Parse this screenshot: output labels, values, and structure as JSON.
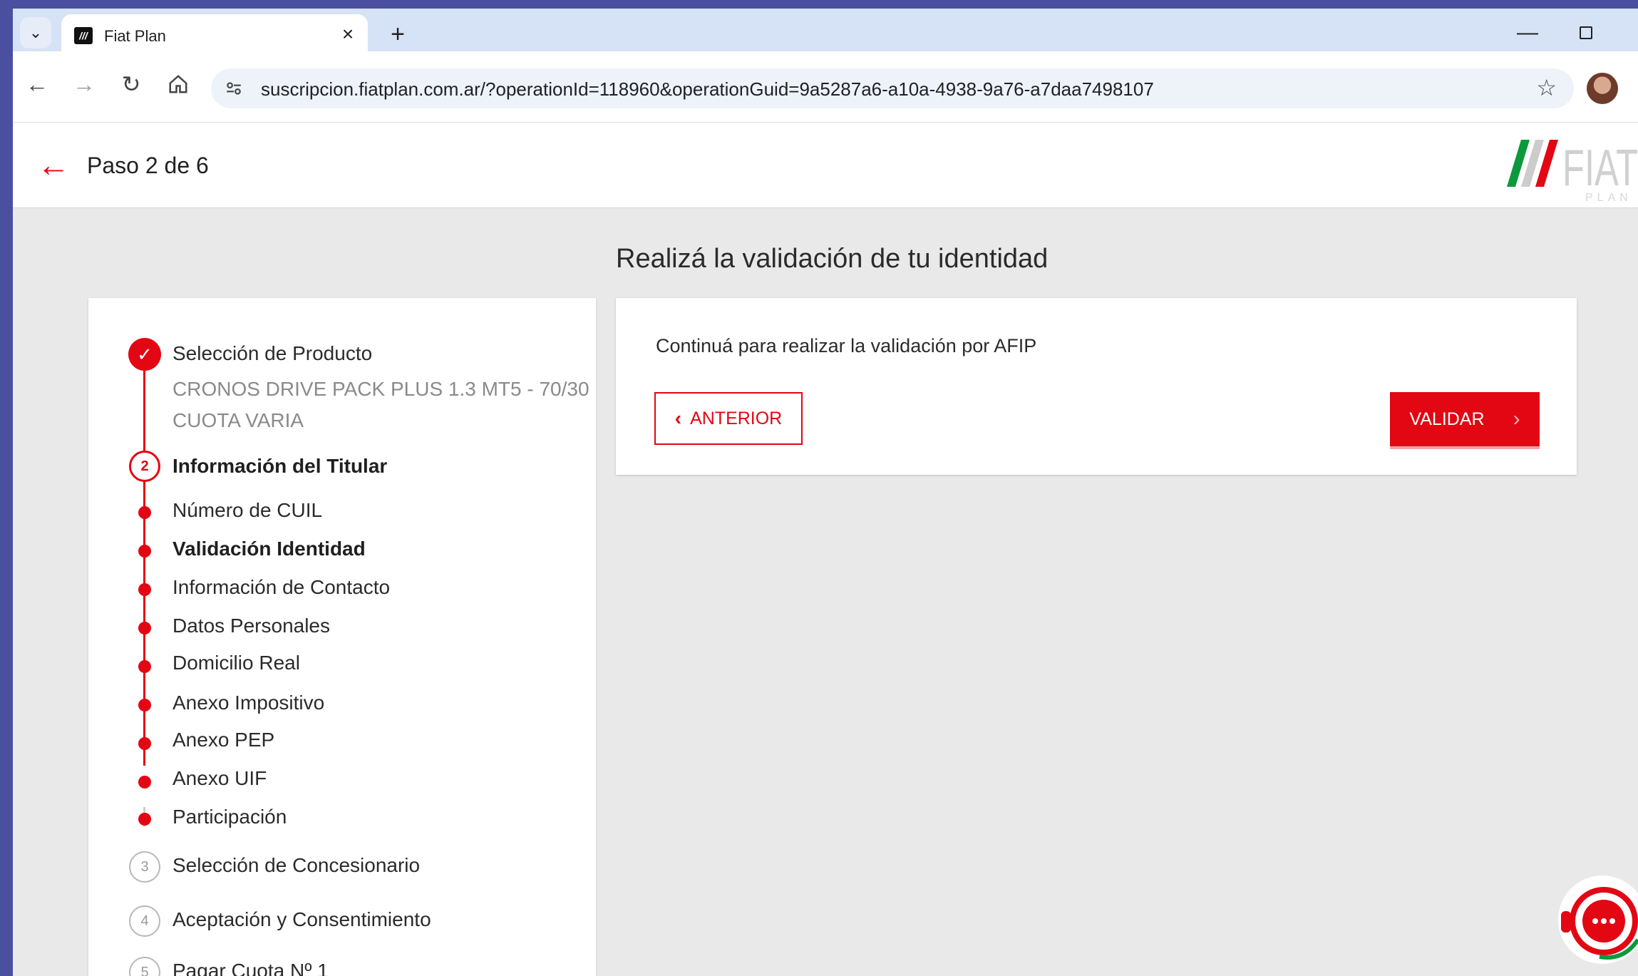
{
  "browser": {
    "tab_title": "Fiat Plan",
    "tab_favicon_text": "///",
    "url": "suscripcion.fiatplan.com.ar/?operationId=118960&operationGuid=9a5287a6-a10a-4938-9a76-a7daa7498107",
    "icons": [
      "tab-switch-icon",
      "close-icon",
      "plus-icon",
      "minimize-icon",
      "maximize-icon",
      "back-icon",
      "forward-icon",
      "reload-icon",
      "home-icon",
      "site-info-icon",
      "star-icon",
      "profile-avatar"
    ]
  },
  "header": {
    "step_label": "Paso 2 de 6",
    "logo_text": "FIAT",
    "logo_subtext": "PLAN"
  },
  "main": {
    "title": "Realizá la validación de tu identidad"
  },
  "steps": {
    "step1": {
      "label": "Selección de Producto",
      "product_line1": "CRONOS DRIVE PACK PLUS 1.3 MT5 - 70/30",
      "product_line2": "CUOTA VARIA"
    },
    "step2": {
      "number": "2",
      "label": "Información del Titular",
      "substeps": [
        {
          "label": "Número de CUIL"
        },
        {
          "label": "Validación Identidad"
        },
        {
          "label": "Información de Contacto"
        },
        {
          "label": "Datos Personales"
        },
        {
          "label": "Domicilio Real"
        },
        {
          "label": "Anexo Impositivo"
        },
        {
          "label": "Anexo PEP"
        },
        {
          "label": "Anexo UIF"
        },
        {
          "label": "Participación"
        }
      ]
    },
    "step3": {
      "number": "3",
      "label": "Selección de Concesionario"
    },
    "step4": {
      "number": "4",
      "label": "Aceptación y Consentimiento"
    },
    "step5": {
      "number": "5",
      "label": "Pagar Cuota Nº 1"
    }
  },
  "action": {
    "message": "Continuá para realizar la validación por AFIP",
    "back_label": "ANTERIOR",
    "validate_label": "VALIDAR"
  },
  "colors": {
    "accent": "#e30613",
    "frame": "#4b4f9f",
    "tabbar": "#d6e2f5"
  }
}
